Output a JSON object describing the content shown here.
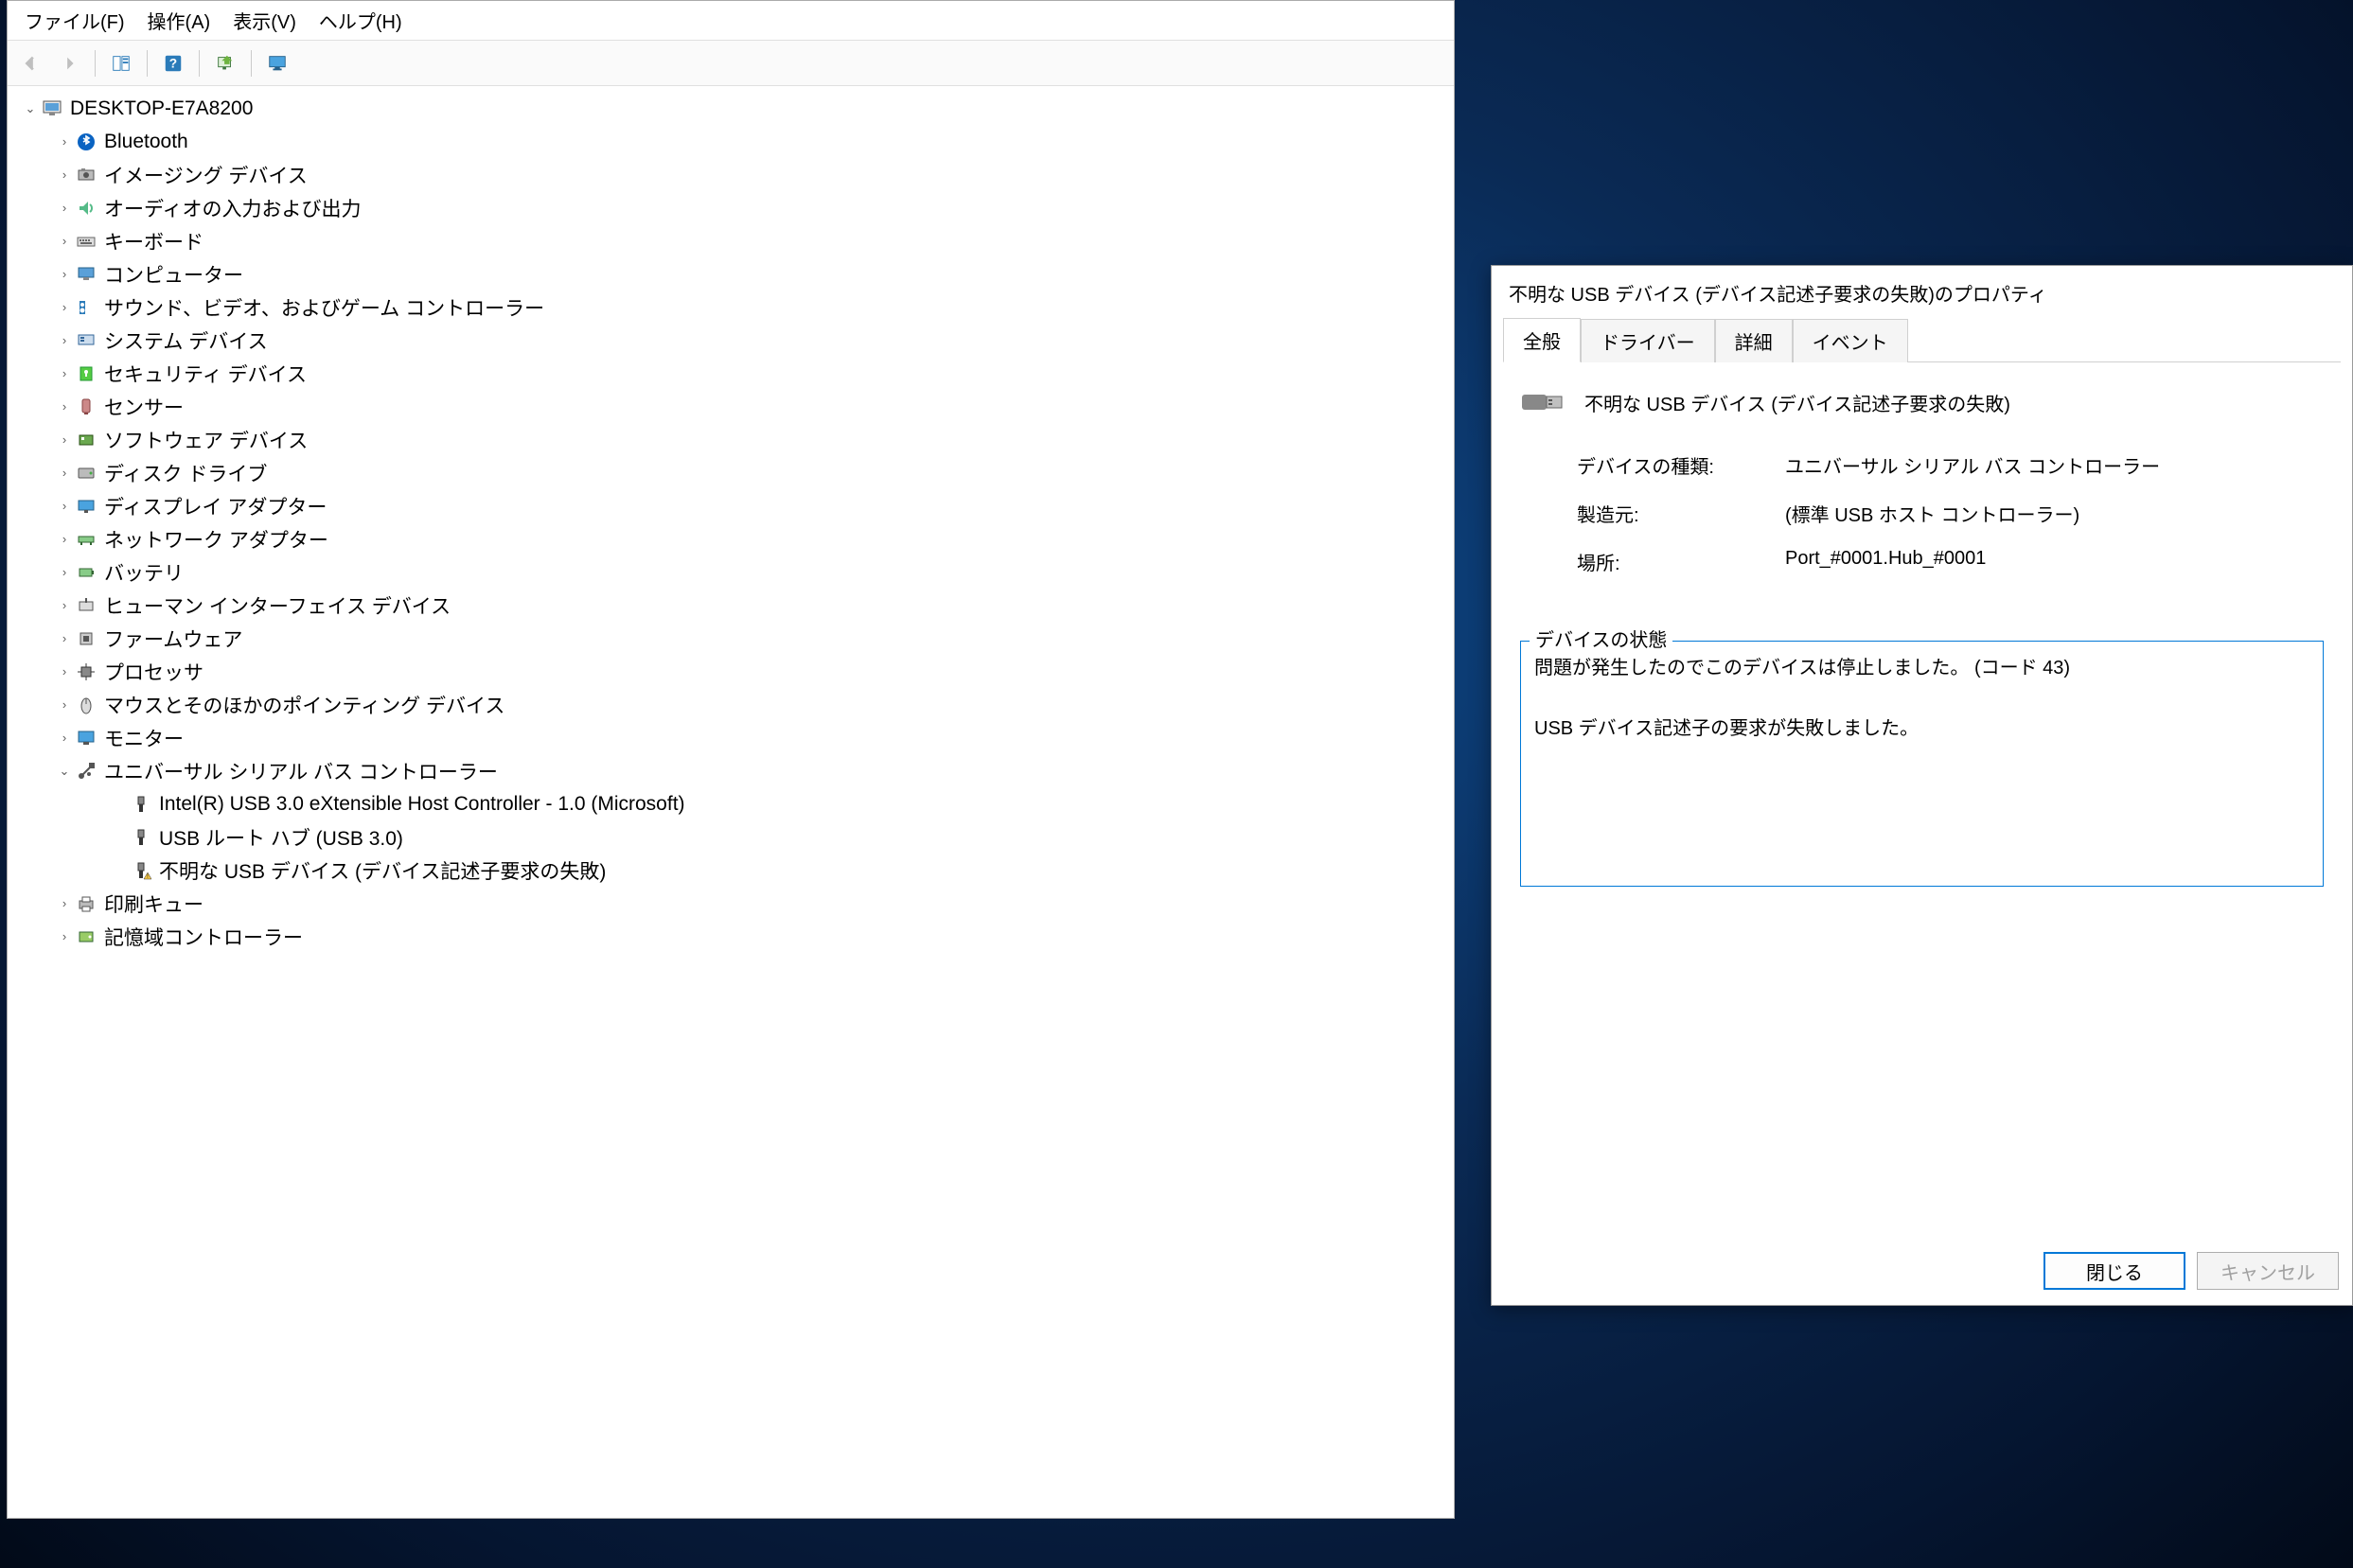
{
  "devmgr": {
    "menu": {
      "file": "ファイル(F)",
      "action": "操作(A)",
      "view": "表示(V)",
      "help": "ヘルプ(H)"
    },
    "root": "DESKTOP-E7A8200",
    "categories": [
      {
        "label": "Bluetooth",
        "icon": "bluetooth"
      },
      {
        "label": "イメージング デバイス",
        "icon": "imaging"
      },
      {
        "label": "オーディオの入力および出力",
        "icon": "audio"
      },
      {
        "label": "キーボード",
        "icon": "keyboard"
      },
      {
        "label": "コンピューター",
        "icon": "computer"
      },
      {
        "label": "サウンド、ビデオ、およびゲーム コントローラー",
        "icon": "sound"
      },
      {
        "label": "システム デバイス",
        "icon": "system"
      },
      {
        "label": "セキュリティ デバイス",
        "icon": "security"
      },
      {
        "label": "センサー",
        "icon": "sensor"
      },
      {
        "label": "ソフトウェア デバイス",
        "icon": "software"
      },
      {
        "label": "ディスク ドライブ",
        "icon": "disk"
      },
      {
        "label": "ディスプレイ アダプター",
        "icon": "display"
      },
      {
        "label": "ネットワーク アダプター",
        "icon": "network"
      },
      {
        "label": "バッテリ",
        "icon": "battery"
      },
      {
        "label": "ヒューマン インターフェイス デバイス",
        "icon": "hid"
      },
      {
        "label": "ファームウェア",
        "icon": "firmware"
      },
      {
        "label": "プロセッサ",
        "icon": "processor"
      },
      {
        "label": "マウスとそのほかのポインティング デバイス",
        "icon": "mouse"
      },
      {
        "label": "モニター",
        "icon": "monitor"
      }
    ],
    "usb_category": "ユニバーサル シリアル バス コントローラー",
    "usb_children": [
      {
        "label": "Intel(R) USB 3.0 eXtensible Host Controller - 1.0 (Microsoft)",
        "warn": false
      },
      {
        "label": "USB ルート ハブ (USB 3.0)",
        "warn": false
      },
      {
        "label": "不明な USB デバイス (デバイス記述子要求の失敗)",
        "warn": true
      }
    ],
    "tail_categories": [
      {
        "label": "印刷キュー",
        "icon": "print"
      },
      {
        "label": "記憶域コントローラー",
        "icon": "storage"
      }
    ]
  },
  "props": {
    "title": "不明な USB デバイス (デバイス記述子要求の失敗)のプロパティ",
    "tabs": {
      "general": "全般",
      "driver": "ドライバー",
      "details": "詳細",
      "events": "イベント"
    },
    "device_name": "不明な USB デバイス (デバイス記述子要求の失敗)",
    "rows": {
      "type_k": "デバイスの種類:",
      "type_v": "ユニバーサル シリアル バス コントローラー",
      "mfr_k": "製造元:",
      "mfr_v": "(標準 USB ホスト コントローラー)",
      "loc_k": "場所:",
      "loc_v": "Port_#0001.Hub_#0001"
    },
    "status_label": "デバイスの状態",
    "status_text": "問題が発生したのでこのデバイスは停止しました。 (コード 43)\n\nUSB デバイス記述子の要求が失敗しました。",
    "buttons": {
      "close": "閉じる",
      "cancel": "キャンセル"
    }
  }
}
